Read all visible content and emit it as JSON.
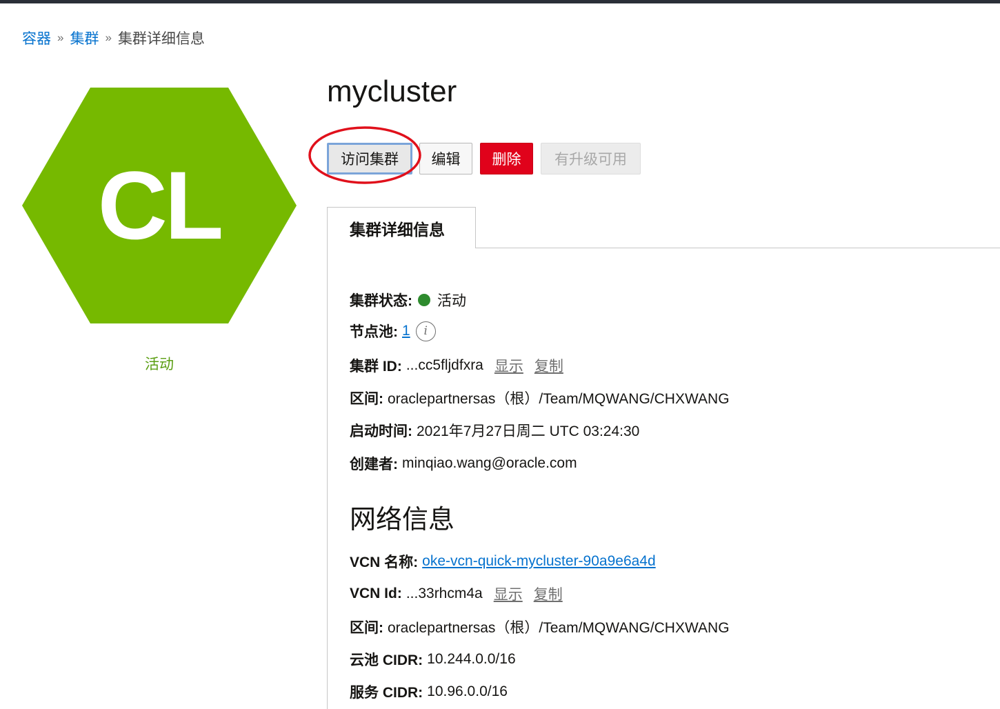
{
  "breadcrumb": {
    "item1": "容器",
    "item2": "集群",
    "current": "集群详细信息",
    "separator": "»"
  },
  "hero": {
    "initials": "CL",
    "status": "活动"
  },
  "page": {
    "title": "mycluster"
  },
  "actions": {
    "access": "访问集群",
    "edit": "编辑",
    "delete": "删除",
    "upgrade": "有升级可用"
  },
  "tab": {
    "label": "集群详细信息"
  },
  "cluster": {
    "status_label": "集群状态:",
    "status_value": "活动",
    "nodepool_label": "节点池:",
    "nodepool_value": "1",
    "id_label": "集群 ID:",
    "id_value": "...cc5fljdfxra",
    "compartment_label": "区间:",
    "compartment_value": "oraclepartnersas（根）/Team/MQWANG/CHXWANG",
    "started_label": "启动时间:",
    "started_value": "2021年7月27日周二 UTC 03:24:30",
    "creator_label": "创建者:",
    "creator_value": "minqiao.wang@oracle.com",
    "show": "显示",
    "copy": "复制",
    "info_glyph": "i"
  },
  "network": {
    "heading": "网络信息",
    "vcn_name_label": "VCN 名称:",
    "vcn_name_value": "oke-vcn-quick-mycluster-90a9e6a4d",
    "vcn_id_label": "VCN Id:",
    "vcn_id_value": "...33rhcm4a",
    "compartment_label": "区间:",
    "compartment_value": "oraclepartnersas（根）/Team/MQWANG/CHXWANG",
    "pod_cidr_label": "云池 CIDR:",
    "pod_cidr_value": "10.244.0.0/16",
    "svc_cidr_label": "服务 CIDR:",
    "svc_cidr_value": "10.96.0.0/16"
  },
  "colors": {
    "hexagon": "#76b900",
    "status_text": "#5a9e12",
    "status_dot": "#2e8b2e",
    "link": "#0572ce",
    "delete_button": "#e0021b",
    "annotation": "#e0101b"
  },
  "icons": {
    "info": "info-icon",
    "status": "status-dot-icon",
    "annotation": "red-ellipse-highlight"
  }
}
